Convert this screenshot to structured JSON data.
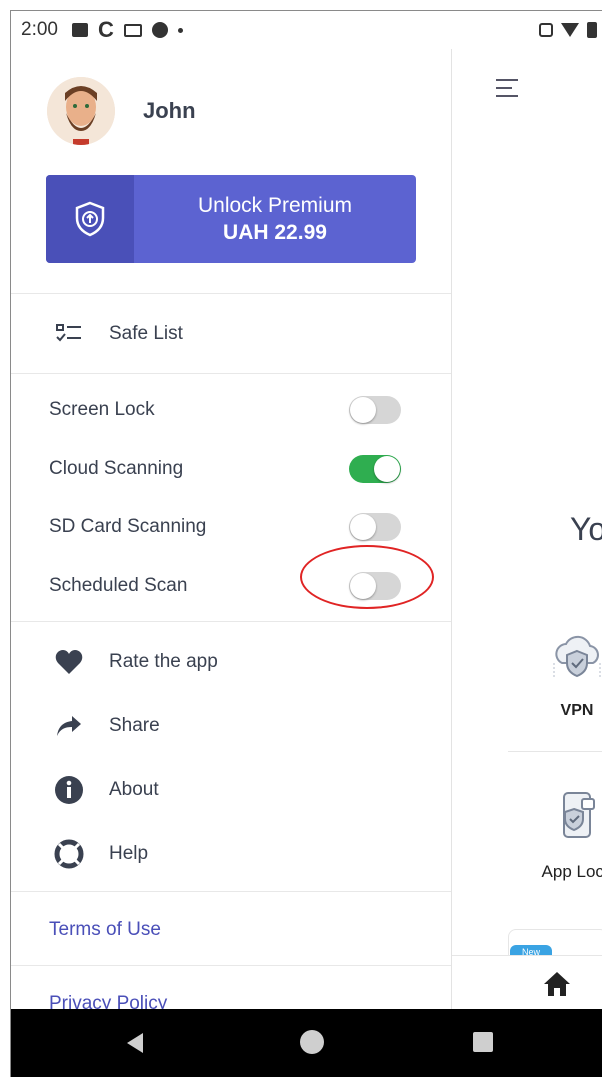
{
  "status_bar": {
    "time": "2:00",
    "left_icons": [
      "photo-icon",
      "c-app-icon",
      "mail-icon",
      "circle-alert-icon",
      "dot-icon"
    ],
    "right_icons": [
      "vibrate-icon",
      "wifi-icon",
      "battery-icon"
    ]
  },
  "drawer": {
    "profile": {
      "name": "John"
    },
    "premium": {
      "title": "Unlock Premium",
      "price": "UAH 22.99",
      "icon": "shield-upgrade-icon"
    },
    "safe_list": {
      "label": "Safe List",
      "icon": "checklist-icon"
    },
    "toggles": [
      {
        "label": "Screen Lock",
        "on": false
      },
      {
        "label": "Cloud Scanning",
        "on": true
      },
      {
        "label": "SD Card Scanning",
        "on": false
      },
      {
        "label": "Scheduled Scan",
        "on": false
      }
    ],
    "actions": [
      {
        "label": "Rate the app",
        "icon": "heart-icon"
      },
      {
        "label": "Share",
        "icon": "share-arrow-icon"
      },
      {
        "label": "About",
        "icon": "info-icon"
      },
      {
        "label": "Help",
        "icon": "lifebuoy-icon"
      }
    ],
    "links": {
      "terms": "Terms of Use",
      "privacy": "Privacy Policy"
    }
  },
  "main": {
    "greeting_partial": "You",
    "features": [
      {
        "label": "VPN",
        "icon": "cloud-shield-icon"
      },
      {
        "label": "App Lock",
        "icon": "phone-lock-icon"
      }
    ],
    "badge": "New",
    "bottom_nav": {
      "icon": "home-icon"
    }
  },
  "colors": {
    "accent": "#5c63d1",
    "accent_dark": "#4a50b8",
    "toggle_on": "#2fae50",
    "link": "#4a4fb8",
    "highlight": "#e02424"
  }
}
